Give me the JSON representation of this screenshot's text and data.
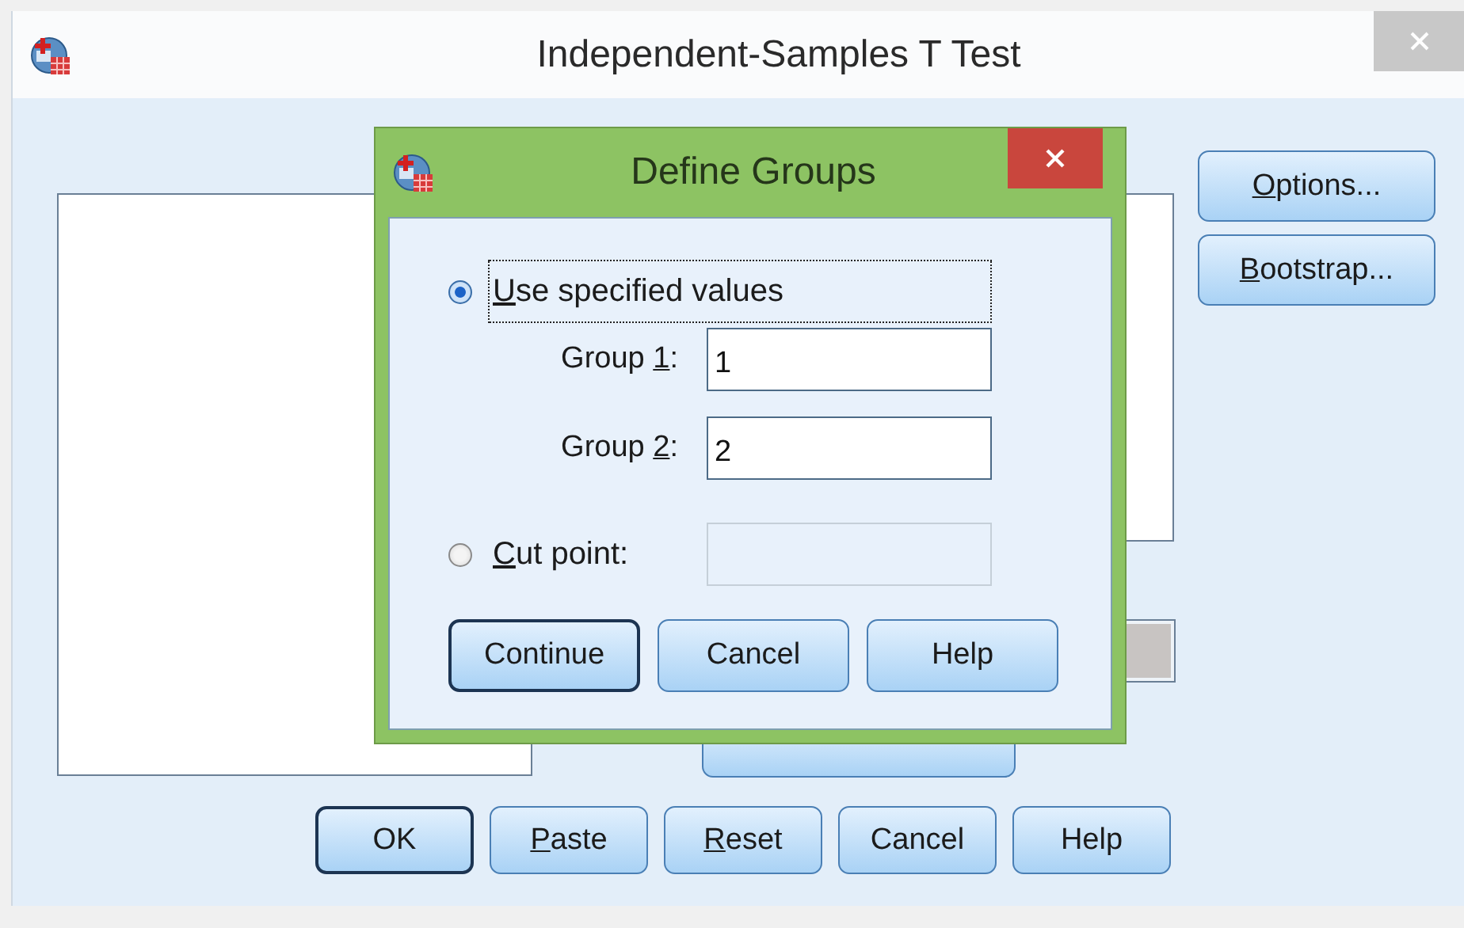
{
  "window": {
    "title": "Independent-Samples T Test",
    "side_buttons": [
      {
        "key": "O",
        "after": "ptions..."
      },
      {
        "key": "B",
        "after": "ootstrap..."
      }
    ],
    "bottom_buttons": [
      {
        "label": {
          "after": "OK"
        },
        "default": true
      },
      {
        "label": {
          "key": "P",
          "after": "aste"
        },
        "default": false
      },
      {
        "label": {
          "key": "R",
          "after": "eset"
        },
        "default": false
      },
      {
        "label": {
          "after": "Cancel"
        },
        "default": false
      },
      {
        "label": {
          "after": "Help"
        },
        "default": false
      }
    ]
  },
  "dialog": {
    "title": "Define Groups",
    "rows": [
      {
        "kind": "radio",
        "label": {
          "key": "U",
          "after": "se specified values"
        },
        "selected": true,
        "focused": true
      },
      {
        "kind": "field",
        "label": {
          "before": "Group ",
          "key": "1",
          "after": ":"
        },
        "value": "1"
      },
      {
        "kind": "field",
        "label": {
          "before": "Group ",
          "key": "2",
          "after": ":"
        },
        "value": "2"
      },
      {
        "kind": "radio",
        "label": {
          "key": "C",
          "after": "ut point:"
        },
        "selected": false,
        "focused": false,
        "field": {
          "disabled": true
        }
      }
    ],
    "buttons": [
      {
        "label": {
          "after": "Continue"
        },
        "default": true
      },
      {
        "label": {
          "after": "Cancel"
        },
        "default": false
      },
      {
        "label": {
          "after": "Help"
        },
        "default": false
      }
    ]
  }
}
